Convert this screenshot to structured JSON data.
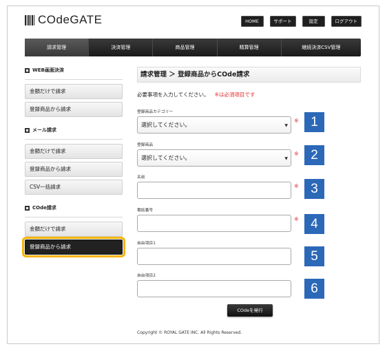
{
  "header": {
    "logo_text": "COdeGATE",
    "top_nav": [
      "HOME",
      "サポート",
      "設定",
      "ログアウト"
    ]
  },
  "main_nav": {
    "tabs": [
      "請求管理",
      "決済管理",
      "商品管理",
      "精算管理",
      "継続決済CSV管理"
    ],
    "active_index": 0
  },
  "sidebar": {
    "sections": [
      {
        "title": "WEB画面決済",
        "items": [
          "金額だけで請求",
          "登録商品から請求"
        ]
      },
      {
        "title": "メール請求",
        "items": [
          "金額だけで請求",
          "登録商品から請求",
          "CSV一括請求"
        ]
      },
      {
        "title": "COde請求",
        "items": [
          "金額だけで請求",
          "登録商品から請求"
        ]
      }
    ],
    "active_item": "COde請求/登録商品から請求"
  },
  "content": {
    "title": "請求管理 ＞ 登録商品からCOde請求",
    "instruction": "必要事項を入力してください。",
    "required_note": "※は必須項目です",
    "fields": [
      {
        "label": "登録商品カテゴリー",
        "type": "select",
        "value": "選択してください。",
        "required": true,
        "badge": "1"
      },
      {
        "label": "登録商品",
        "type": "select",
        "value": "選択してください。",
        "required": true,
        "badge": "2"
      },
      {
        "label": "名前",
        "type": "text",
        "value": "",
        "required": true,
        "badge": "3"
      },
      {
        "label": "電話番号",
        "type": "text",
        "value": "",
        "required": true,
        "badge": "4"
      },
      {
        "label": "自由項目1",
        "type": "text",
        "value": "",
        "required": false,
        "badge": "5"
      },
      {
        "label": "自由項目2",
        "type": "text",
        "value": "",
        "required": false,
        "badge": "6"
      }
    ],
    "required_mark": "※",
    "submit_label": "COdeを発行",
    "copyright": "Copyright © ROYAL GATE INC. All Rights Reserved."
  },
  "colors": {
    "badge": "#2c68b8",
    "required": "#e03030",
    "highlight_outline": "#f5b400",
    "nav_dark": "#1f1f1f"
  },
  "icons": {
    "logo": "barcode-icon",
    "section": "square-bullet-icon",
    "select": "caret-down-icon"
  }
}
